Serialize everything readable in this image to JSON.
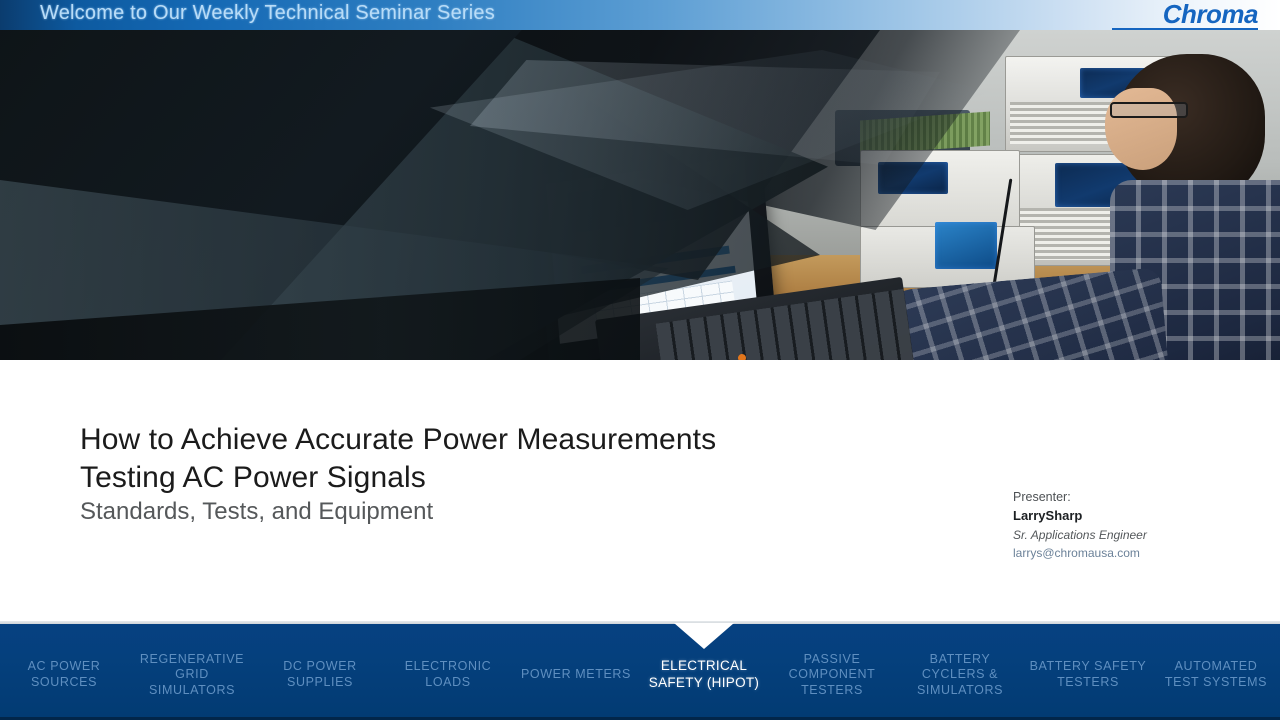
{
  "banner": {
    "welcome_text": "Welcome to Our Weekly Technical Seminar Series",
    "logo_text": "Chroma",
    "gradient_start": "#0b3c6e",
    "gradient_end": "#ffffff",
    "logo_color": "#1565c0"
  },
  "hero": {
    "alt": "Engineer at a lab bench operating a laptop beside Chroma power test instruments",
    "overlay_style": "dark angular brand wedges"
  },
  "main": {
    "title_line_1": "How to Achieve Accurate Power Measurements",
    "title_line_2": "Testing AC Power Signals",
    "subtitle": "Standards, Tests, and Equipment",
    "title_color": "#1b1b1b",
    "subtitle_color": "#55585a"
  },
  "presenter": {
    "label": "Presenter:",
    "name": "LarrySharp",
    "role": "Sr. Applications Engineer",
    "email": "larrys@chromausa.com",
    "email_color": "#6c8299"
  },
  "nav": {
    "background_color": "#05407d",
    "inactive_color": "#5f8fc0",
    "active_color": "#ffffff",
    "active_index": 5,
    "items": [
      {
        "label": "AC POWER\nSOURCES",
        "active": false
      },
      {
        "label": "REGENERATIVE\nGRID\nSIMULATORS",
        "active": false
      },
      {
        "label": "DC POWER\nSUPPLIES",
        "active": false
      },
      {
        "label": "ELECTRONIC\nLOADS",
        "active": false
      },
      {
        "label": "POWER METERS",
        "active": false
      },
      {
        "label": "ELECTRICAL\nSAFETY (HIPOT)",
        "active": true
      },
      {
        "label": "PASSIVE\nCOMPONENT\nTESTERS",
        "active": false
      },
      {
        "label": "BATTERY\nCYCLERS &\nSIMULATORS",
        "active": false
      },
      {
        "label": "BATTERY SAFETY\nTESTERS",
        "active": false
      },
      {
        "label": "AUTOMATED\nTEST SYSTEMS",
        "active": false
      }
    ]
  }
}
